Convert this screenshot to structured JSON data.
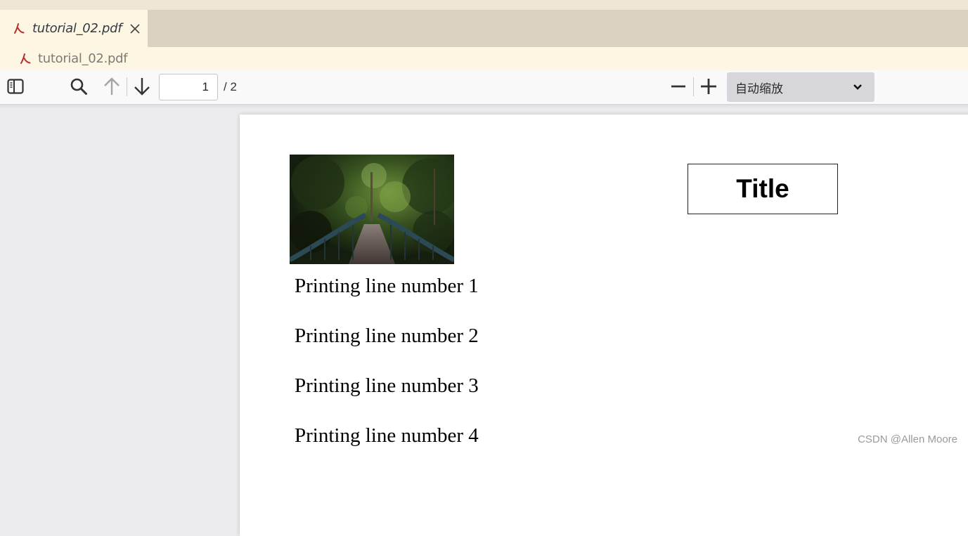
{
  "tabs": [
    {
      "label": "tutorial_02.pdf",
      "icon": "pdf-file-icon",
      "active": true,
      "italic": true
    }
  ],
  "breadcrumb": {
    "label": "tutorial_02.pdf",
    "icon": "pdf-file-icon"
  },
  "toolbar": {
    "page_current": "1",
    "page_total_label": "/ 2",
    "zoom_selected": "自动缩放",
    "icons": {
      "sidebar_toggle": "sidebar-toggle-icon",
      "find": "search-icon",
      "previous": "arrow-up-icon",
      "next": "arrow-down-icon",
      "zoom_out": "minus-icon",
      "zoom_in": "plus-icon"
    }
  },
  "document": {
    "image_description": "Forest footbridge photo",
    "title": "Title",
    "lines": [
      "Printing line number 1",
      "Printing line number 2",
      "Printing line number 3",
      "Printing line number 4"
    ]
  },
  "watermark": "CSDN @Allen Moore",
  "colors": {
    "pdf_icon": "#b3302f",
    "tab_active_bg": "#fdf6e3",
    "tab_bar_bg": "#d9d2c1",
    "toolbar_bg": "#f9f9fa",
    "zoom_select_bg": "#d7d7db",
    "viewer_bg": "#ececee"
  }
}
